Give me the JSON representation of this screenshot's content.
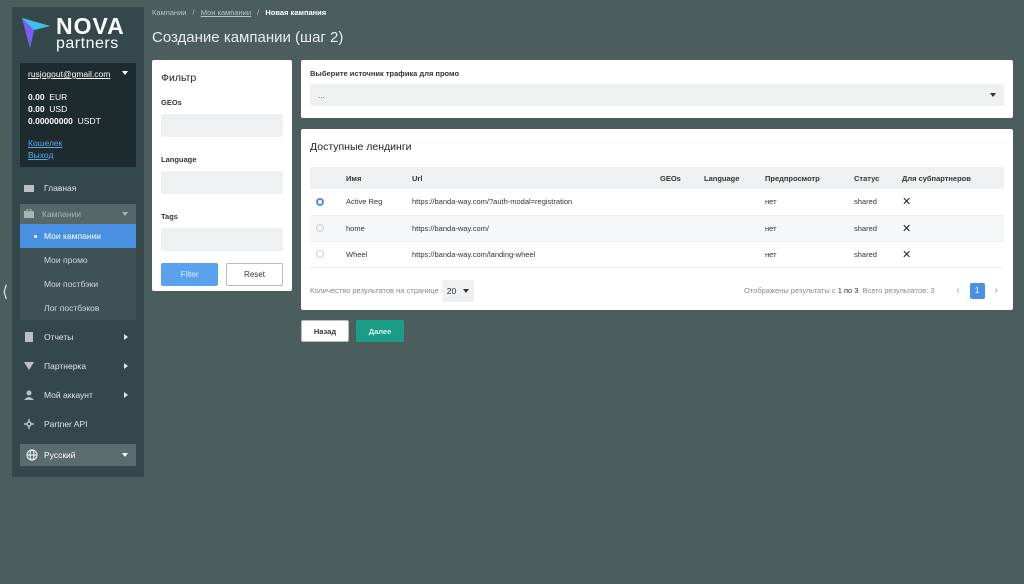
{
  "logo": {
    "nova": "NOVA",
    "partners": "partners"
  },
  "account": {
    "email": "rusjogout@gmail.com",
    "balances": [
      {
        "amount": "0.00",
        "currency": "EUR"
      },
      {
        "amount": "0.00",
        "currency": "USD"
      },
      {
        "amount": "0.00000000",
        "currency": "USDT"
      }
    ],
    "wallet_link": "Кошелек",
    "logout_link": "Выход"
  },
  "sidebar": {
    "home": "Главная",
    "campaigns": "Кампании",
    "campaign_items": [
      "Мои кампании",
      "Мои промо",
      "Мои постбэки",
      "Лог постбэков"
    ],
    "reports": "Отчеты",
    "partnership": "Партнерка",
    "my_account": "Мой аккаунт",
    "partner_api": "Partner API",
    "language": "Русский"
  },
  "breadcrumb": {
    "root": "Кампании",
    "parent": "Мои кампании",
    "current": "Новая кампания",
    "sep": "/"
  },
  "page_title": "Создание кампании (шаг 2)",
  "filter": {
    "title": "Фильтр",
    "geos_label": "GEOs",
    "language_label": "Language",
    "tags_label": "Tags",
    "filter_button": "Filter",
    "reset_button": "Reset"
  },
  "source": {
    "label": "Выберите источник трафика для промо",
    "value": "..."
  },
  "landings": {
    "title": "Доступные лендинги",
    "columns": [
      "Имя",
      "Url",
      "GEOs",
      "Language",
      "Предпросмотр",
      "Статус",
      "Для субпартнеров"
    ],
    "rows": [
      {
        "name": "Active Reg",
        "url": "https://banda-way.com/?auth-modal=registration",
        "geos": "",
        "language": "",
        "preview": "нет",
        "status": "shared",
        "selected": true
      },
      {
        "name": "home",
        "url": "https://banda-way.com/",
        "geos": "",
        "language": "",
        "preview": "нет",
        "status": "shared",
        "selected": false
      },
      {
        "name": "Wheel",
        "url": "https://banda-way.com/landing-wheel",
        "geos": "",
        "language": "",
        "preview": "нет",
        "status": "shared",
        "selected": false
      }
    ],
    "per_page_label": "Количество результатов на странице",
    "per_page_value": "20",
    "results_text": "Отображены результаты с ",
    "results_range": "1 по 3",
    "results_total": ". Всего результатов: 3",
    "current_page": "1"
  },
  "buttons": {
    "back": "Назад",
    "next": "Далее"
  },
  "colors": {
    "background": "#4c5d5d",
    "sidebar": "#34474a",
    "accent": "#4a90e2",
    "next": "#1a9c86"
  }
}
